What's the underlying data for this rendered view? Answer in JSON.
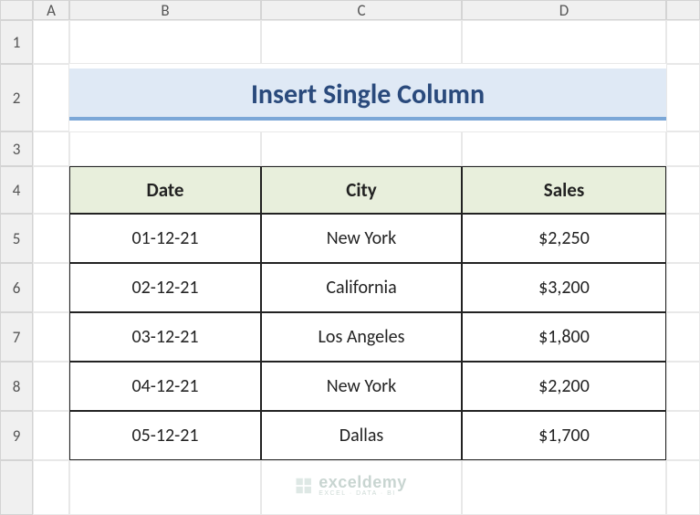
{
  "columns": [
    "A",
    "B",
    "C",
    "D"
  ],
  "rows": [
    "1",
    "2",
    "3",
    "4",
    "5",
    "6",
    "7",
    "8",
    "9"
  ],
  "title": "Insert Single Column",
  "table": {
    "headers": [
      "Date",
      "City",
      "Sales"
    ],
    "data": [
      {
        "date": "01-12-21",
        "city": "New York",
        "sales": "$2,250"
      },
      {
        "date": "02-12-21",
        "city": "California",
        "sales": "$3,200"
      },
      {
        "date": "03-12-21",
        "city": "Los Angeles",
        "sales": "$1,800"
      },
      {
        "date": "04-12-21",
        "city": "New York",
        "sales": "$2,200"
      },
      {
        "date": "05-12-21",
        "city": "Dallas",
        "sales": "$1,700"
      }
    ]
  },
  "watermark": {
    "main": "exceldemy",
    "sub": "EXCEL · DATA · BI"
  },
  "chart_data": {
    "type": "table",
    "title": "Insert Single Column",
    "headers": [
      "Date",
      "City",
      "Sales"
    ],
    "rows": [
      [
        "01-12-21",
        "New York",
        2250
      ],
      [
        "02-12-21",
        "California",
        3200
      ],
      [
        "03-12-21",
        "Los Angeles",
        1800
      ],
      [
        "04-12-21",
        "New York",
        2200
      ],
      [
        "05-12-21",
        "Dallas",
        1700
      ]
    ]
  }
}
